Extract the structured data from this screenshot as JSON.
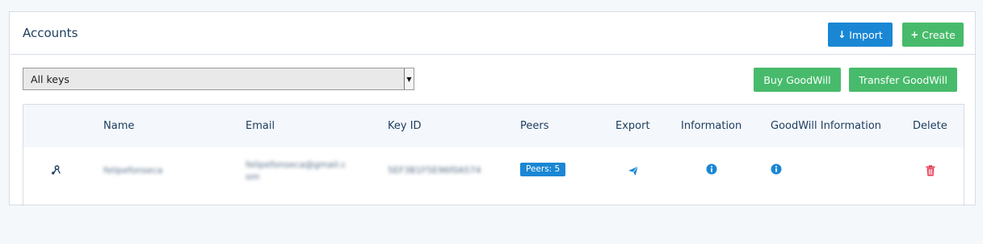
{
  "panel": {
    "title": "Accounts"
  },
  "toolbar": {
    "import_label": "Import",
    "create_label": "Create",
    "buy_goodwill_label": "Buy GoodWill",
    "transfer_goodwill_label": "Transfer GoodWill"
  },
  "filter": {
    "selected": "All keys"
  },
  "table": {
    "columns": [
      "Name",
      "Email",
      "Key ID",
      "Peers",
      "Export",
      "Information",
      "GoodWill Information",
      "Delete"
    ],
    "rows": [
      {
        "name": "felipefonseca",
        "email_line1": "felipefonseca@gmail.c",
        "email_line2": "om",
        "key_id": "5EF3B1F5E96f0A574",
        "peers": "Peers: 5"
      }
    ]
  },
  "icons": {
    "row_icon": "key-user-icon",
    "export": "paper-plane-icon",
    "information": "info-circle-icon",
    "goodwill_information": "info-circle-icon",
    "delete": "trash-icon",
    "import": "arrow-down-icon",
    "create": "plus-icon"
  },
  "colors": {
    "primary": "#1a87d4",
    "success": "#47bb6b",
    "danger": "#e8384f",
    "text": "#1d3c5e"
  }
}
